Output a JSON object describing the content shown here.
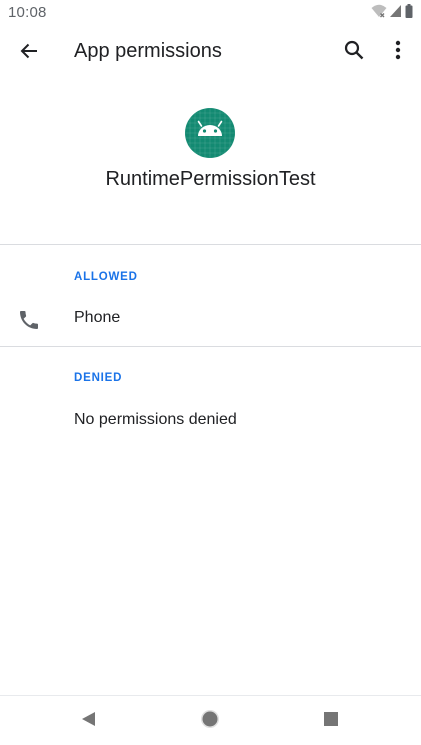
{
  "status_bar": {
    "time": "10:08",
    "icons": [
      "wifi-icon",
      "signal-icon",
      "battery-icon"
    ]
  },
  "app_bar": {
    "title": "App permissions",
    "icons": [
      "back-arrow-icon",
      "search-icon",
      "more-vert-icon"
    ]
  },
  "app": {
    "name": "RuntimePermissionTest",
    "icon": "android-app-icon",
    "icon_color": "#138a72"
  },
  "sections": {
    "allowed": {
      "header": "ALLOWED",
      "items": [
        {
          "label": "Phone",
          "icon": "phone-icon"
        }
      ]
    },
    "denied": {
      "header": "DENIED",
      "empty_text": "No permissions denied"
    }
  },
  "nav_bar": {
    "icons": [
      "nav-back-icon",
      "nav-home-icon",
      "nav-recents-icon"
    ]
  },
  "colors": {
    "accent": "#1a73e8",
    "text_primary": "#202124",
    "text_secondary": "#5f6368",
    "divider": "#dadce0"
  }
}
